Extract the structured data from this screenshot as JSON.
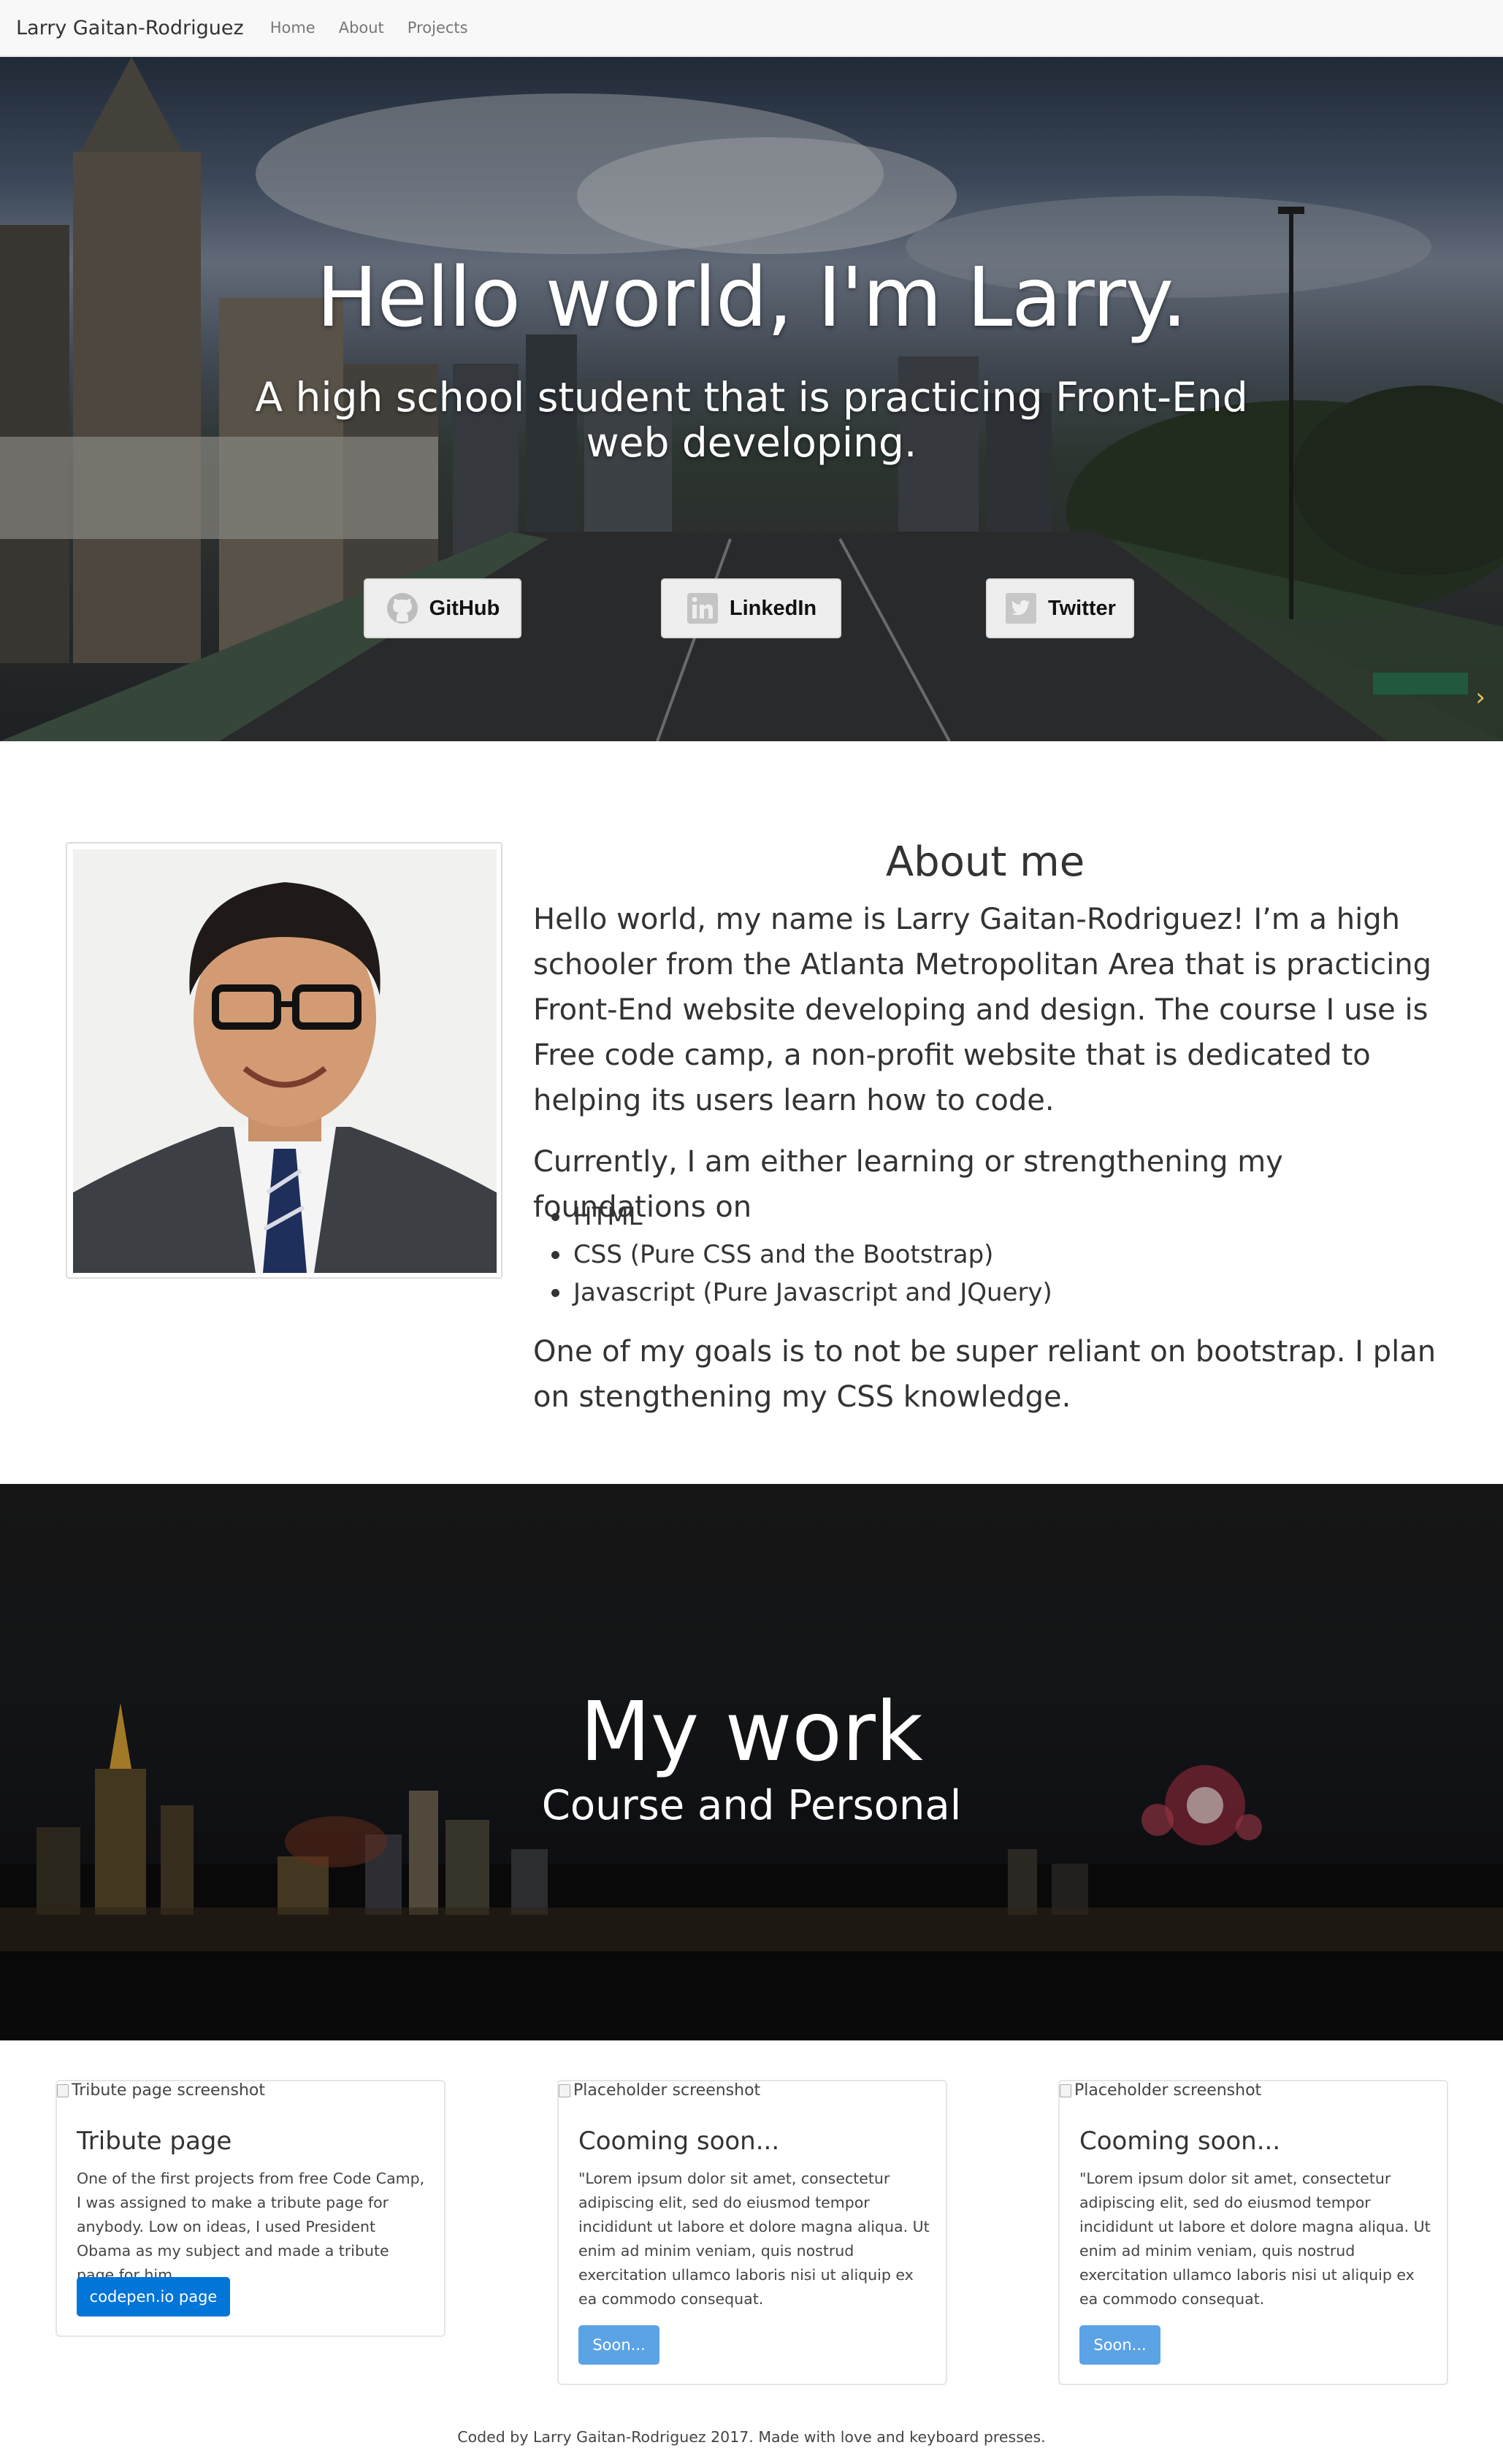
{
  "navbar": {
    "brand": "Larry Gaitan-Rodriguez",
    "links": [
      "Home",
      "About",
      "Projects"
    ]
  },
  "hero": {
    "title": "Hello world, I'm Larry.",
    "subtitle": "A high school student that is practicing Front-End web developing.",
    "buttons": [
      {
        "label": "GitHub",
        "icon": "github-icon"
      },
      {
        "label": "LinkedIn",
        "icon": "linkedin-icon"
      },
      {
        "label": "Twitter",
        "icon": "twitter-icon"
      }
    ]
  },
  "about": {
    "title": "About me",
    "intro": "Hello world, my name is Larry Gaitan-Rodriguez! I’m a high schooler from the Atlanta Metropolitan Area that is practicing Front-End website developing and design. The course I use is Free code camp, a non-profit website that is dedicated to helping its users learn how to code.",
    "currently": "Currently, I am either learning or strengthening my foundations on",
    "skills": [
      "HTML",
      "CSS (Pure CSS and the Bootstrap)",
      "Javascript (Pure Javascript and JQuery)"
    ],
    "goals": "One of my goals is to not be super reliant on bootstrap. I plan on stengthening my CSS knowledge."
  },
  "work": {
    "title": "My work",
    "subtitle": "Course and Personal"
  },
  "projects": [
    {
      "img_alt": "Tribute page screenshot",
      "title": "Tribute page",
      "text": "One of the first projects from free Code Camp, I was assigned to make a tribute page for anybody. Low on ideas, I used President Obama as my subject and made a tribute page for him.",
      "button": "codepen.io page"
    },
    {
      "img_alt": "Placeholder screenshot",
      "title": "Cooming soon...",
      "text": "\"Lorem ipsum dolor sit amet, consectetur adipiscing elit, sed do eiusmod tempor incididunt ut labore et dolore magna aliqua. Ut enim ad minim veniam, quis nostrud exercitation ullamco laboris nisi ut aliquip ex ea commodo consequat.",
      "button": "Soon..."
    },
    {
      "img_alt": "Placeholder screenshot",
      "title": "Cooming soon...",
      "text": "\"Lorem ipsum dolor sit amet, consectetur adipiscing elit, sed do eiusmod tempor incididunt ut labore et dolore magna aliqua. Ut enim ad minim veniam, quis nostrud exercitation ullamco laboris nisi ut aliquip ex ea commodo consequat.",
      "button": "Soon..."
    }
  ],
  "footer": "Coded by Larry Gaitan-Rodriguez 2017. Made with love and keyboard presses.",
  "colors": {
    "primary_button": "#0275d8",
    "disabled_button": "#5ca3e6",
    "navbar_bg": "#f8f8f8"
  }
}
